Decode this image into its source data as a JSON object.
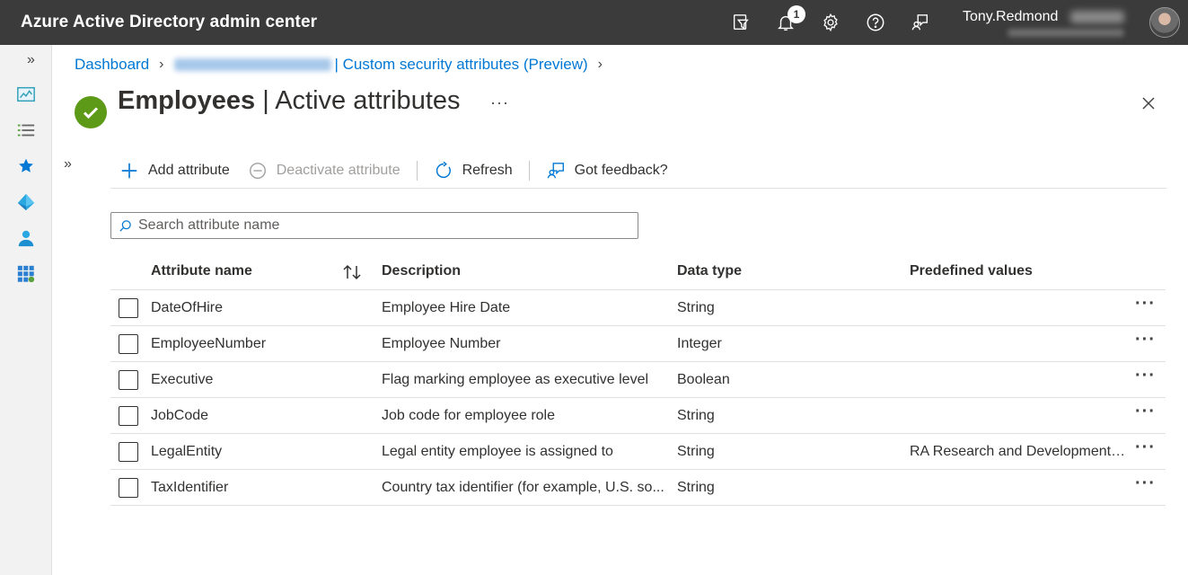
{
  "app": {
    "title": "Azure Active Directory admin center"
  },
  "topbar": {
    "notification_count": "1",
    "user_name": "Tony.Redmond"
  },
  "breadcrumb": {
    "items": [
      "Dashboard",
      "| Custom security attributes (Preview)"
    ]
  },
  "header": {
    "title_bold": "Employees",
    "title_rest": " | Active attributes",
    "more": "···"
  },
  "toolbar": {
    "add_label": "Add attribute",
    "deactivate_label": "Deactivate attribute",
    "refresh_label": "Refresh",
    "feedback_label": "Got feedback?"
  },
  "search": {
    "placeholder": "Search attribute name"
  },
  "table": {
    "columns": [
      "Attribute name",
      "Description",
      "Data type",
      "Predefined values"
    ],
    "rows": [
      {
        "name": "DateOfHire",
        "description": "Employee Hire Date",
        "type": "String",
        "predefined": ""
      },
      {
        "name": "EmployeeNumber",
        "description": "Employee Number",
        "type": "Integer",
        "predefined": ""
      },
      {
        "name": "Executive",
        "description": "Flag marking employee as executive level",
        "type": "Boolean",
        "predefined": ""
      },
      {
        "name": "JobCode",
        "description": "Job code for employee role",
        "type": "String",
        "predefined": ""
      },
      {
        "name": "LegalEntity",
        "description": "Legal entity employee is assigned to",
        "type": "String",
        "predefined": "RA Research and Development, ..."
      },
      {
        "name": "TaxIdentifier",
        "description": "Country tax identifier (for example, U.S. so...",
        "type": "String",
        "predefined": ""
      }
    ]
  },
  "colors": {
    "topbar": "#3b3b3b",
    "accent": "#0078d4",
    "success": "#5c9a17",
    "rail": "#f2f2f2"
  },
  "icons": {
    "topbar": [
      "filter-feedback-icon",
      "bell-icon",
      "gear-icon",
      "help-icon",
      "feedback-icon"
    ],
    "rail": [
      "dashboard-icon",
      "all-services-icon",
      "favorites-star-icon",
      "azure-ad-icon",
      "users-icon",
      "enterprise-apps-icon"
    ]
  }
}
